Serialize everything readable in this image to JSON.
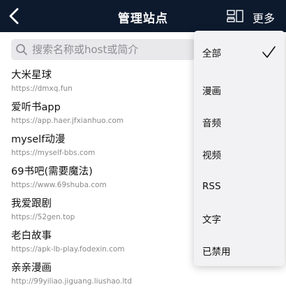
{
  "header": {
    "title": "管理站点",
    "more_label": "更多"
  },
  "search": {
    "placeholder": "搜索名称或host或简介",
    "value": ""
  },
  "sites": [
    {
      "name": "大米星球",
      "url": "https://dmxq.fun"
    },
    {
      "name": "爱听书app",
      "url": "https://app.haer.jfxianhuo.com"
    },
    {
      "name": "myself动漫",
      "url": "https://myself-bbs.com"
    },
    {
      "name": "69书吧(需要魔法)",
      "url": "https://www.69shuba.com"
    },
    {
      "name": "我爱跟剧",
      "url": "https://52gen.top"
    },
    {
      "name": "老白故事",
      "url": "https://apk-lb-play.fodexin.com"
    },
    {
      "name": "亲亲漫画",
      "url": "http://99yiliao.jiguang.liushao.ltd"
    }
  ],
  "menu": {
    "items": [
      {
        "label": "全部",
        "checked": true
      },
      {
        "label": "漫画",
        "checked": false
      },
      {
        "label": "音频",
        "checked": false
      },
      {
        "label": "视频",
        "checked": false
      },
      {
        "label": "RSS",
        "checked": false
      },
      {
        "label": "文字",
        "checked": false
      },
      {
        "label": "已禁用",
        "checked": false
      }
    ]
  },
  "colors": {
    "navbar_bg": "#0d1a2e",
    "menu_bg": "#f2f2f4",
    "search_bg": "#e9e9eb",
    "url_text": "#8a8a8a"
  },
  "icons": {
    "back": "chevron-left-icon",
    "layout": "layout-toggle-icon",
    "search": "search-icon",
    "check": "check-icon"
  }
}
